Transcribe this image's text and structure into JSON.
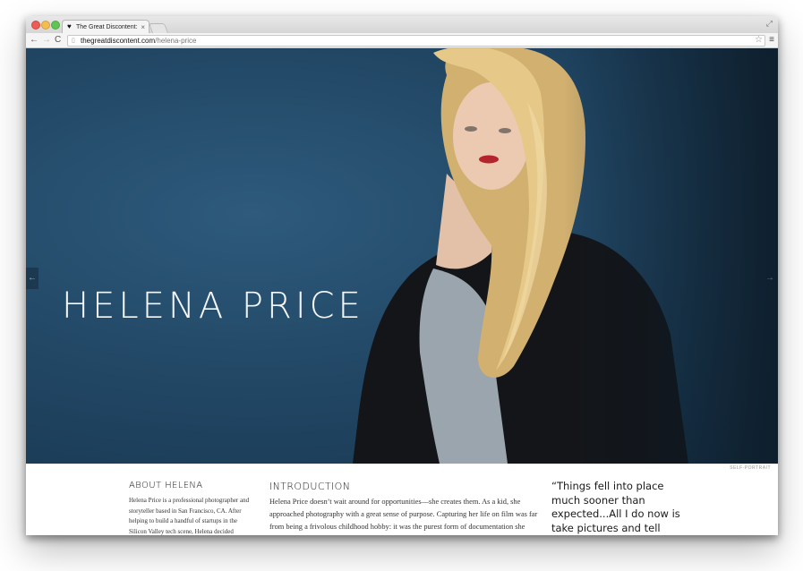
{
  "browser": {
    "tab_title": "The Great Discontent: Helena Price",
    "tab_close": "×",
    "tab_favicon": "heart-icon",
    "url_domain": "thegreatdiscontent.com",
    "url_path": "/helena-price",
    "nav_back": "←",
    "nav_forward": "→",
    "nav_reload": "C",
    "bookmark_icon": "star-icon",
    "menu_icon": "hamburger-menu-icon"
  },
  "hero": {
    "title": "HELENA PRICE",
    "prev_arrow": "←",
    "next_arrow": "→",
    "caption": "SELF-PORTRAIT",
    "colors": {
      "background": "#224866",
      "title": "#f4f7fa"
    }
  },
  "about": {
    "heading": "ABOUT HELENA",
    "text": "Helena Price is a professional photographer and storyteller based in San Francisco, CA. After helping to build a handful of startups in the Silicon Valley tech scene, Helena decided"
  },
  "introduction": {
    "heading": "INTRODUCTION",
    "text": "Helena Price doesn’t wait around for opportunities—she creates them. As a kid, she approached photography with a great sense of purpose. Capturing her life on film was far from being a frivolous childhood hobby: it was the purest form of documentation she knew. This dedication to storytelling became a driving force"
  },
  "quote": {
    "text": "“Things fell into place much sooner than expected...All I do now is take pictures and tell stories—it’s my dream. I"
  }
}
